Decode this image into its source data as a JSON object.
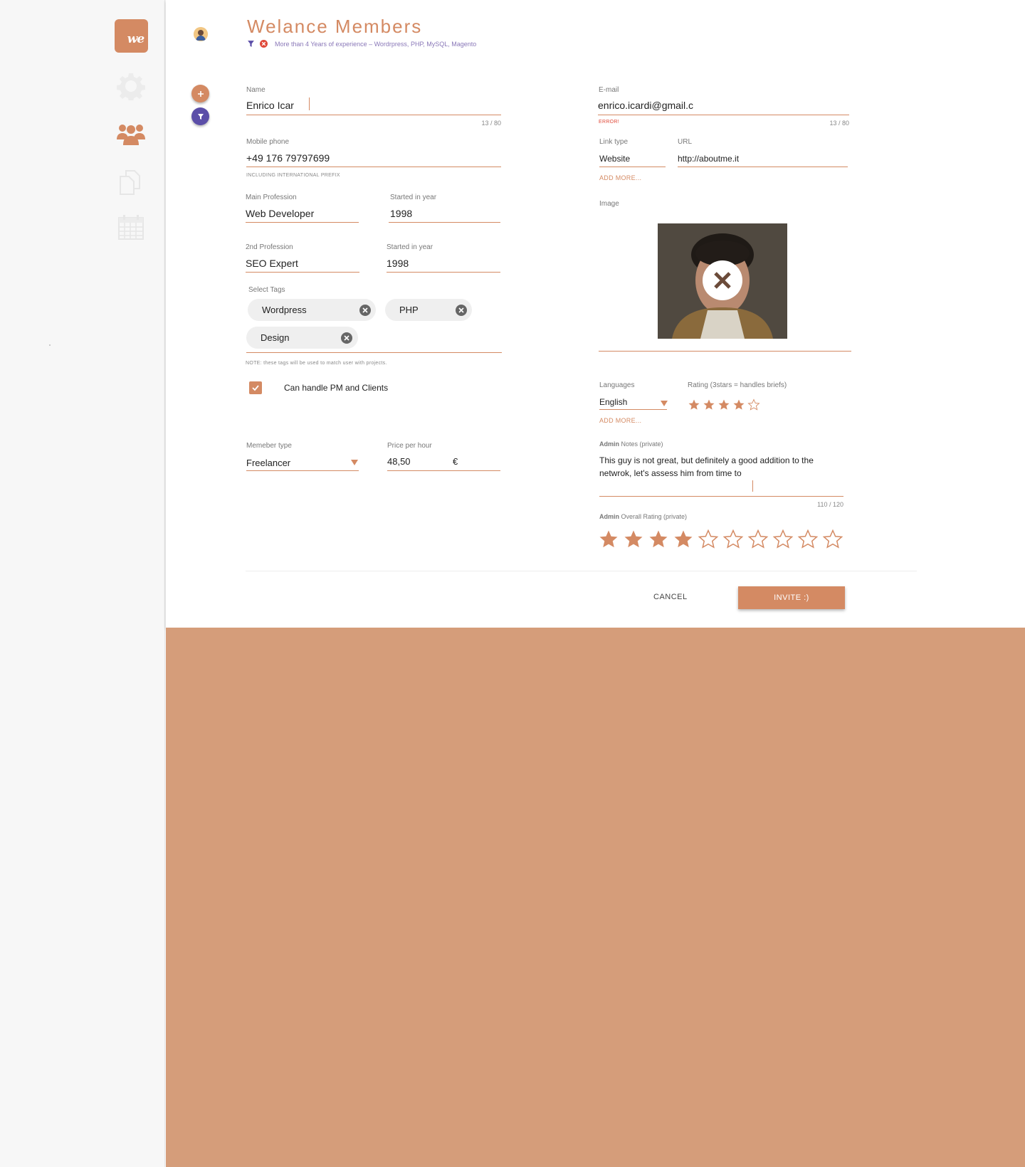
{
  "app": {
    "logo_text": "we",
    "title": "Welance Members",
    "filter_text": "More than 4 Years of experience – Wordrpress, PHP, MySQL, Magento"
  },
  "sidebar": {
    "items": [
      {
        "icon": "gear-icon",
        "active": false
      },
      {
        "icon": "users-icon",
        "active": true
      },
      {
        "icon": "documents-icon",
        "active": false
      },
      {
        "icon": "calendar-icon",
        "active": false
      }
    ]
  },
  "form": {
    "name": {
      "label": "Name",
      "value": "Enrico Icar",
      "counter": "13 / 80"
    },
    "email": {
      "label": "E-mail",
      "value": "enrico.icardi@gmail.c",
      "error": "ERROR!",
      "counter": "13 / 80"
    },
    "mobile": {
      "label": "Mobile phone",
      "value": "+49 176 79797699",
      "helper": "INCLUDING INTERNATIONAL PREFIX"
    },
    "link_type": {
      "label": "Link type",
      "value": "Website"
    },
    "url": {
      "label": "URL",
      "value": "http://aboutme.it"
    },
    "add_more_links": "ADD MORE...",
    "main_profession": {
      "label": "Main Profession",
      "value": "Web Developer"
    },
    "main_started": {
      "label": "Started in year",
      "value": "1998"
    },
    "second_profession": {
      "label": "2nd Profession",
      "value": "SEO Expert"
    },
    "second_started": {
      "label": "Started in year",
      "value": "1998"
    },
    "image": {
      "label": "Image"
    },
    "tags": {
      "label": "Select Tags",
      "items": [
        "Wordpress",
        "PHP",
        "Design"
      ],
      "note": "NOTE: these tags will be used to match user with projects."
    },
    "pm_checkbox": {
      "label": "Can handle PM and Clients",
      "checked": true
    },
    "languages": {
      "label": "Languages",
      "value": "English",
      "add_more": "ADD MORE..."
    },
    "language_rating": {
      "label": "Rating (3stars = handles briefs)",
      "value": 4,
      "max": 5
    },
    "member_type": {
      "label": "Memeber type",
      "value": "Freelancer"
    },
    "price": {
      "label": "Price per hour",
      "value": "48,50",
      "currency": "€"
    },
    "admin_notes": {
      "label_bold": "Admin",
      "label_rest": " Notes (private)",
      "value": "This guy is not great, but definitely a good addition to the netwrok, let's assess him from time to",
      "counter": "110 / 120"
    },
    "admin_rating": {
      "label_bold": "Admin",
      "label_rest": " Overall Rating (private)",
      "value": 4,
      "max": 10
    }
  },
  "actions": {
    "cancel": "CANCEL",
    "invite": "INVITE :)"
  },
  "colors": {
    "accent": "#d48a63",
    "accent_bg": "#d59d7a",
    "filter_purple": "#5b4ea8",
    "error": "#e04a3a"
  }
}
